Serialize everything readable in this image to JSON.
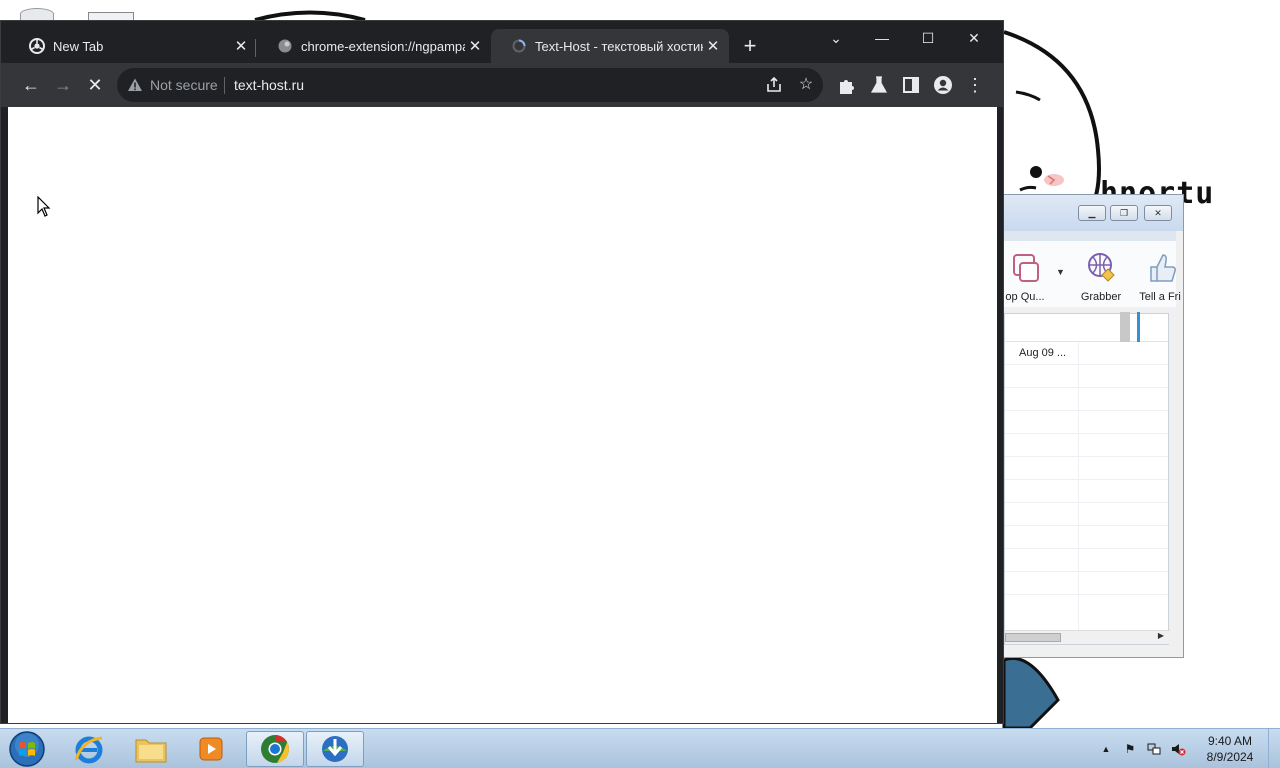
{
  "desktop": {
    "wallpaper_text": "hnortu"
  },
  "background_window": {
    "toolbar_buttons": [
      {
        "label": "op Qu...",
        "icon": "stop-queue-icon"
      },
      {
        "label": "Grabber",
        "icon": "grabber-icon"
      },
      {
        "label": "Tell a Fri",
        "icon": "thumbs-up-icon"
      }
    ],
    "list_rows": [
      "Aug 09 ...",
      "",
      "",
      "",
      "",
      "",
      "",
      "",
      "",
      "",
      "",
      "",
      ""
    ]
  },
  "chrome": {
    "tabs": [
      {
        "title": "New Tab",
        "icon": "chrome-logo-icon",
        "active": false
      },
      {
        "title": "chrome-extension://ngpampappnmepgilojfohadhhmbhlaek/captured.html",
        "icon": "extension-page-icon",
        "active": false
      },
      {
        "title": "Text-Host - текстовый хостинг",
        "icon": "loading-spinner-icon",
        "active": true
      }
    ],
    "new_tab_label": "+",
    "window_controls": {
      "tab_search": "⌄",
      "minimize": "—",
      "maximize": "☐",
      "close": "✕"
    },
    "nav": {
      "back": "←",
      "forward": "→",
      "stop": "✕"
    },
    "omnibox": {
      "security_label": "Not secure",
      "url": "text-host.ru"
    }
  },
  "taskbar": {
    "pinned": [
      {
        "name": "start-button",
        "icon": "windows-orb-icon"
      },
      {
        "name": "internet-explorer",
        "icon": "ie-icon"
      },
      {
        "name": "file-explorer",
        "icon": "folder-icon"
      },
      {
        "name": "media-player",
        "icon": "media-player-icon"
      },
      {
        "name": "chrome",
        "icon": "chrome-icon",
        "running": true
      },
      {
        "name": "download-manager",
        "icon": "idm-icon",
        "running": true
      }
    ],
    "clock": {
      "time": "9:40 AM",
      "date": "8/9/2024"
    }
  },
  "colors": {
    "chrome_frame": "#202124",
    "chrome_toolbar": "#35363a",
    "taskbar": "#b9cfe6"
  }
}
